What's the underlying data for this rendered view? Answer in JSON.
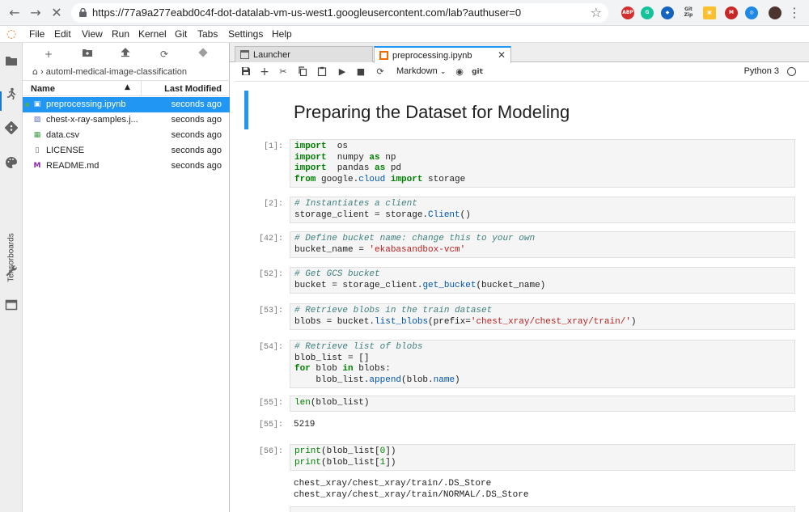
{
  "browser": {
    "url": "https://77a9a277eabd0c4f-dot-datalab-vm-us-west1.googleusercontent.com/lab?authuser=0",
    "extensions": [
      {
        "icon": "abp-icon",
        "text": "ABP",
        "color": "#d32f2f"
      },
      {
        "icon": "grammarly-icon",
        "text": "G",
        "color": "#15c39a"
      },
      {
        "icon": "extension-blue-icon",
        "text": "◆",
        "color": "#1565c0"
      },
      {
        "icon": "gitzip-icon",
        "text": "Git Zip",
        "color": "#424242"
      },
      {
        "icon": "image-extension-icon",
        "text": "▣",
        "color": "#fbc02d"
      },
      {
        "icon": "m-extension-icon",
        "text": "M",
        "color": "#c62828"
      },
      {
        "icon": "camera-extension-icon",
        "text": "◎",
        "color": "#1e88e5"
      }
    ]
  },
  "menubar": [
    "File",
    "Edit",
    "View",
    "Run",
    "Kernel",
    "Git",
    "Tabs",
    "Settings",
    "Help"
  ],
  "activity": {
    "tensorboards_label": "Tensorboards"
  },
  "filebrowser": {
    "breadcrumb": "automl-medical-image-classification",
    "col_name": "Name",
    "col_modified": "Last Modified",
    "files": [
      {
        "name": "preprocessing.ipynb",
        "modified": "seconds ago",
        "icon": "notebook-icon",
        "selected": true,
        "running": true
      },
      {
        "name": "chest-x-ray-samples.j...",
        "modified": "seconds ago",
        "icon": "image-file-icon",
        "selected": false,
        "running": false
      },
      {
        "name": "data.csv",
        "modified": "seconds ago",
        "icon": "spreadsheet-icon",
        "selected": false,
        "running": false
      },
      {
        "name": "LICENSE",
        "modified": "seconds ago",
        "icon": "file-icon",
        "selected": false,
        "running": false
      },
      {
        "name": "README.md",
        "modified": "seconds ago",
        "icon": "markdown-icon",
        "selected": false,
        "running": false
      }
    ]
  },
  "tabs": [
    {
      "label": "Launcher",
      "active": false
    },
    {
      "label": "preprocessing.ipynb",
      "active": true
    }
  ],
  "toolbar": {
    "cell_type": "Markdown",
    "git_label": "git",
    "kernel_name": "Python 3"
  },
  "notebook": {
    "heading": "Preparing the Dataset for Modeling",
    "cells": [
      {
        "prompt": "[1]:",
        "lines": [
          [
            [
              "kw",
              "import"
            ],
            [
              "",
              "  os"
            ]
          ],
          [
            [
              "kw",
              "import"
            ],
            [
              "",
              "  numpy "
            ],
            [
              "kw",
              "as"
            ],
            [
              "",
              " np"
            ]
          ],
          [
            [
              "kw",
              "import"
            ],
            [
              "",
              "  pandas "
            ],
            [
              "kw",
              "as"
            ],
            [
              "",
              " pd"
            ]
          ],
          [
            [
              "kw",
              "from"
            ],
            [
              "",
              " google."
            ],
            [
              "fn",
              "cloud"
            ],
            [
              "",
              " "
            ],
            [
              "kw",
              "import"
            ],
            [
              "",
              " storage"
            ]
          ]
        ],
        "output": null
      },
      {
        "prompt": "[2]:",
        "lines": [
          [
            [
              "cm",
              "# Instantiates a client"
            ]
          ],
          [
            [
              "",
              "storage_client = storage."
            ],
            [
              "fn",
              "Client"
            ],
            [
              "",
              "()"
            ]
          ]
        ],
        "output": null
      },
      {
        "prompt": "[42]:",
        "lines": [
          [
            [
              "cm",
              "# Define bucket name: change this to your own"
            ]
          ],
          [
            [
              "",
              "bucket_name = "
            ],
            [
              "st",
              "'ekabasandbox-vcm'"
            ]
          ]
        ],
        "output": null
      },
      {
        "prompt": "[52]:",
        "lines": [
          [
            [
              "cm",
              "# Get GCS bucket"
            ]
          ],
          [
            [
              "",
              "bucket = storage_client."
            ],
            [
              "fn",
              "get_bucket"
            ],
            [
              "",
              "(bucket_name)"
            ]
          ]
        ],
        "output": null
      },
      {
        "prompt": "[53]:",
        "lines": [
          [
            [
              "cm",
              "# Retrieve blobs in the train dataset"
            ]
          ],
          [
            [
              "",
              "blobs = bucket."
            ],
            [
              "fn",
              "list_blobs"
            ],
            [
              "",
              "(prefix="
            ],
            [
              "st",
              "'chest_xray/chest_xray/train/'"
            ],
            [
              "",
              ")"
            ]
          ]
        ],
        "output": null
      },
      {
        "prompt": "[54]:",
        "lines": [
          [
            [
              "cm",
              "# Retrieve list of blobs"
            ]
          ],
          [
            [
              "",
              "blob_list = []"
            ]
          ],
          [
            [
              "kw",
              "for"
            ],
            [
              "",
              " blob "
            ],
            [
              "kw",
              "in"
            ],
            [
              "",
              " blobs:"
            ]
          ],
          [
            [
              "",
              "    blob_list."
            ],
            [
              "fn",
              "append"
            ],
            [
              "",
              "(blob."
            ],
            [
              "fn",
              "name"
            ],
            [
              "",
              ")"
            ]
          ]
        ],
        "output": null
      },
      {
        "prompt": "[55]:",
        "lines": [
          [
            [
              "bi",
              "len"
            ],
            [
              "",
              "(blob_list)"
            ]
          ]
        ],
        "output_prompt": "[55]:",
        "output": [
          "5219"
        ]
      },
      {
        "prompt": "[56]:",
        "lines": [
          [
            [
              "bi",
              "print"
            ],
            [
              "",
              "(blob_list["
            ],
            [
              "nu",
              "0"
            ],
            [
              "",
              "])"
            ]
          ],
          [
            [
              "bi",
              "print"
            ],
            [
              "",
              "(blob_list["
            ],
            [
              "nu",
              "1"
            ],
            [
              "",
              "])"
            ]
          ]
        ],
        "output_prompt": "",
        "output": [
          "chest_xray/chest_xray/train/.DS_Store",
          "chest_xray/chest_xray/train/NORMAL/.DS_Store"
        ]
      }
    ]
  }
}
